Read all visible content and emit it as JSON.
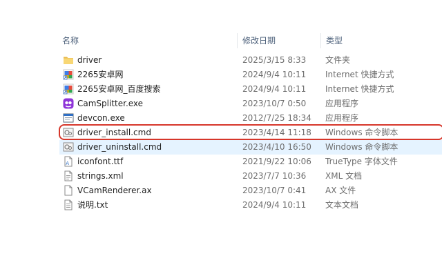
{
  "header": {
    "name_label": "名称",
    "date_label": "修改日期",
    "type_label": "类型"
  },
  "files": [
    {
      "name": "driver",
      "date": "2025/3/15 8:33",
      "type": "文件夹",
      "icon": "folder-icon"
    },
    {
      "name": "2265安卓网",
      "date": "2024/9/4 10:11",
      "type": "Internet 快捷方式",
      "icon": "internet-shortcut-icon"
    },
    {
      "name": "2265安卓网_百度搜索",
      "date": "2024/9/4 10:11",
      "type": "Internet 快捷方式",
      "icon": "internet-shortcut-icon"
    },
    {
      "name": "CamSplitter.exe",
      "date": "2023/10/7 0:50",
      "type": "应用程序",
      "icon": "app-purple-icon"
    },
    {
      "name": "devcon.exe",
      "date": "2012/7/25 18:34",
      "type": "应用程序",
      "icon": "app-window-icon"
    },
    {
      "name": "driver_install.cmd",
      "date": "2023/4/14 11:18",
      "type": "Windows 命令脚本",
      "icon": "cmd-script-icon"
    },
    {
      "name": "driver_uninstall.cmd",
      "date": "2023/4/10 16:50",
      "type": "Windows 命令脚本",
      "icon": "cmd-script-icon"
    },
    {
      "name": "iconfont.ttf",
      "date": "2021/9/22 10:06",
      "type": "TrueType 字体文件",
      "icon": "font-file-icon"
    },
    {
      "name": "strings.xml",
      "date": "2023/7/7 10:36",
      "type": "XML 文档",
      "icon": "xml-document-icon"
    },
    {
      "name": "VCamRenderer.ax",
      "date": "2023/10/7 0:41",
      "type": "AX 文件",
      "icon": "blank-file-icon"
    },
    {
      "name": "说明.txt",
      "date": "2024/9/4 10:11",
      "type": "文本文档",
      "icon": "text-file-icon"
    }
  ],
  "selected_file": "driver_uninstall.cmd",
  "highlighted_file": "driver_install.cmd",
  "colors": {
    "selection": "#e5f3ff",
    "highlight_border": "#d6362a",
    "header_text": "#4c607a",
    "secondary_text": "#6d6d6d"
  }
}
